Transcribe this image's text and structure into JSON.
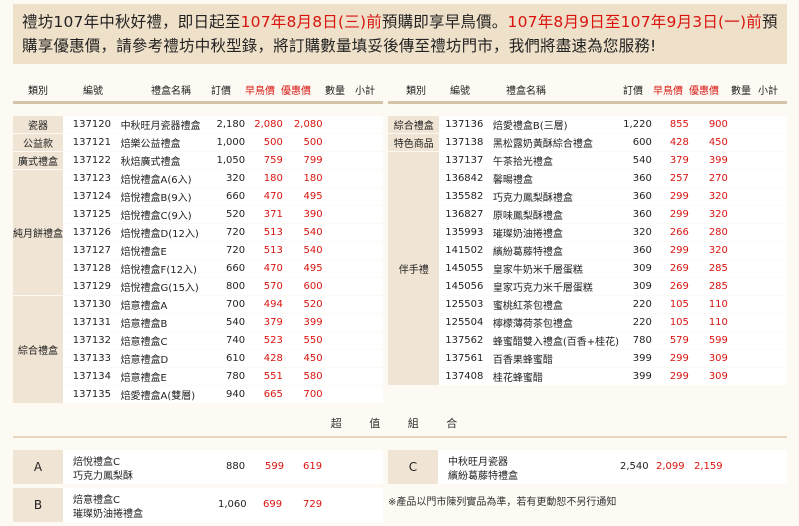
{
  "banner": {
    "part1": "禮坊107年中秋好禮，即日起至",
    "date1": "107年8月8日(三)前",
    "part2": "預購即享早鳥價。",
    "date2": "107年8月9日至107年9月3日(一)前",
    "part3": "預購享優惠價，請參考禮坊中秋型錄，將訂購數量填妥後傳至禮坊門市，我們將盡速為您服務!"
  },
  "columns": {
    "category": "類別",
    "code": "編號",
    "name": "禮盒名稱",
    "list_price": "訂價",
    "early_price": "早鳥價",
    "promo_price": "優惠價",
    "qty": "數量",
    "subtotal": "小計"
  },
  "left_table": [
    {
      "cat": "瓷器",
      "code": "137120",
      "name": "中秋旺月瓷器禮盒",
      "list": "2,180",
      "early": "2,080",
      "promo": "2,080"
    },
    {
      "cat": "公益款",
      "code": "137121",
      "name": "焙樂公益禮盒",
      "list": "1,000",
      "early": "500",
      "promo": "500"
    },
    {
      "cat": "廣式禮盒",
      "code": "137122",
      "name": "秋焙廣式禮盒",
      "list": "1,050",
      "early": "759",
      "promo": "799"
    },
    {
      "cat": "純月餅禮盒",
      "code": "137123",
      "name": "焙悅禮盒A(6入)",
      "list": "320",
      "early": "180",
      "promo": "180"
    },
    {
      "cat": "",
      "code": "137124",
      "name": "焙悅禮盒B(9入)",
      "list": "660",
      "early": "470",
      "promo": "495"
    },
    {
      "cat": "",
      "code": "137125",
      "name": "焙悅禮盒C(9入)",
      "list": "520",
      "early": "371",
      "promo": "390"
    },
    {
      "cat": "",
      "code": "137126",
      "name": "焙悅禮盒D(12入)",
      "list": "720",
      "early": "513",
      "promo": "540"
    },
    {
      "cat": "",
      "code": "137127",
      "name": "焙悅禮盒E",
      "list": "720",
      "early": "513",
      "promo": "540"
    },
    {
      "cat": "",
      "code": "137128",
      "name": "焙悅禮盒F(12入)",
      "list": "660",
      "early": "470",
      "promo": "495"
    },
    {
      "cat": "",
      "code": "137129",
      "name": "焙悅禮盒G(15入)",
      "list": "800",
      "early": "570",
      "promo": "600"
    },
    {
      "cat": "綜合禮盒",
      "code": "137130",
      "name": "焙意禮盒A",
      "list": "700",
      "early": "494",
      "promo": "520"
    },
    {
      "cat": "",
      "code": "137131",
      "name": "焙意禮盒B",
      "list": "540",
      "early": "379",
      "promo": "399"
    },
    {
      "cat": "",
      "code": "137132",
      "name": "焙意禮盒C",
      "list": "740",
      "early": "523",
      "promo": "550"
    },
    {
      "cat": "",
      "code": "137133",
      "name": "焙意禮盒D",
      "list": "610",
      "early": "428",
      "promo": "450"
    },
    {
      "cat": "",
      "code": "137134",
      "name": "焙意禮盒E",
      "list": "780",
      "early": "551",
      "promo": "580"
    },
    {
      "cat": "",
      "code": "137135",
      "name": "焙愛禮盒A(雙層)",
      "list": "940",
      "early": "665",
      "promo": "700"
    }
  ],
  "right_table": [
    {
      "cat": "綜合禮盒",
      "code": "137136",
      "name": "焙愛禮盒B(三層)",
      "list": "1,220",
      "early": "855",
      "promo": "900"
    },
    {
      "cat": "特色商品",
      "code": "137138",
      "name": "黑松露奶黃酥綜合禮盒",
      "list": "600",
      "early": "428",
      "promo": "450"
    },
    {
      "cat": "伴手禮",
      "code": "137137",
      "name": "午茶拾光禮盒",
      "list": "540",
      "early": "379",
      "promo": "399"
    },
    {
      "cat": "",
      "code": "136842",
      "name": "馨暘禮盒",
      "list": "360",
      "early": "257",
      "promo": "270"
    },
    {
      "cat": "",
      "code": "135582",
      "name": "巧克力鳳梨酥禮盒",
      "list": "360",
      "early": "299",
      "promo": "320"
    },
    {
      "cat": "",
      "code": "136827",
      "name": "原味鳳梨酥禮盒",
      "list": "360",
      "early": "299",
      "promo": "320"
    },
    {
      "cat": "",
      "code": "135993",
      "name": "璀璨奶油捲禮盒",
      "list": "320",
      "early": "266",
      "promo": "280"
    },
    {
      "cat": "",
      "code": "141502",
      "name": "繽紛葛藤特禮盒",
      "list": "360",
      "early": "299",
      "promo": "320"
    },
    {
      "cat": "",
      "code": "145055",
      "name": "皇家牛奶米千層蛋糕",
      "list": "309",
      "early": "269",
      "promo": "285"
    },
    {
      "cat": "",
      "code": "145056",
      "name": "皇家巧克力米千層蛋糕",
      "list": "309",
      "early": "269",
      "promo": "285"
    },
    {
      "cat": "",
      "code": "125503",
      "name": "蜜桃紅茶包禮盒",
      "list": "220",
      "early": "105",
      "promo": "110"
    },
    {
      "cat": "",
      "code": "125504",
      "name": "檸檬薄荷茶包禮盒",
      "list": "220",
      "early": "105",
      "promo": "110"
    },
    {
      "cat": "",
      "code": "137562",
      "name": "蜂蜜醋雙入禮盒(百香+桂花)",
      "list": "780",
      "early": "579",
      "promo": "599"
    },
    {
      "cat": "",
      "code": "137561",
      "name": "百香果蜂蜜醋",
      "list": "399",
      "early": "299",
      "promo": "309"
    },
    {
      "cat": "",
      "code": "137408",
      "name": "桂花蜂蜜醋",
      "list": "399",
      "early": "299",
      "promo": "309"
    }
  ],
  "combos": {
    "title": "超 值 組 合",
    "items": [
      {
        "label": "A",
        "line1": "焙悅禮盒C",
        "line2": "巧克力鳳梨酥",
        "list": "880",
        "early": "599",
        "promo": "619"
      },
      {
        "label": "B",
        "line1": "焙意禮盒C",
        "line2": "璀璨奶油捲禮盒",
        "list": "1,060",
        "early": "699",
        "promo": "729"
      },
      {
        "label": "C",
        "line1": "中秋旺月瓷器",
        "line2": "繽紛葛藤特禮盒",
        "list": "2,540",
        "early": "2,099",
        "promo": "2,159"
      }
    ],
    "note": "※產品以門市陳列實品為準，若有更動恕不另行通知"
  },
  "colors": {
    "accent_red": "#d9140f",
    "banner_bg": "#efe0c9",
    "category_bg": "#f0e4d4"
  }
}
